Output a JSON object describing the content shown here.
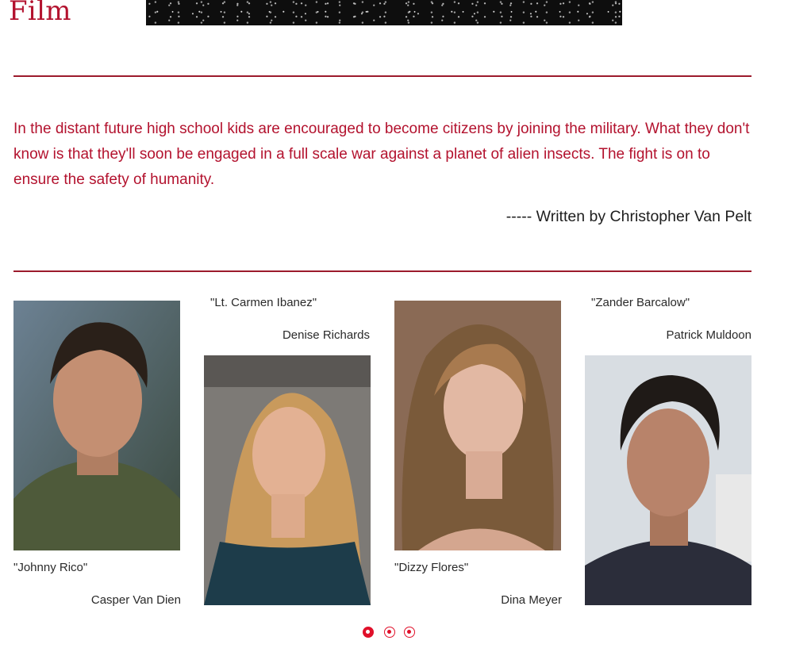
{
  "header": {
    "title": "Film"
  },
  "synopsis": "In the distant future high school kids are encouraged to become citizens by joining the military. What they don't know is that they'll soon be engaged in a full scale war against a planet of alien insects. The fight is on to ensure the safety of humanity.",
  "credit": "----- Written by Christopher Van Pelt",
  "cast": [
    {
      "role": "\"Johnny Rico\"",
      "actor": "Casper Van Dien"
    },
    {
      "role": "\"Lt. Carmen Ibanez\"",
      "actor": "Denise Richards"
    },
    {
      "role": "\"Dizzy Flores\"",
      "actor": "Dina Meyer"
    },
    {
      "role": "\"Zander Barcalow\"",
      "actor": "Patrick Muldoon"
    }
  ],
  "carousel": {
    "pages": 3,
    "active_page": 1
  },
  "colors": {
    "accent": "#b3122e",
    "rule": "#9c1b2c",
    "dot": "#e0102a"
  }
}
